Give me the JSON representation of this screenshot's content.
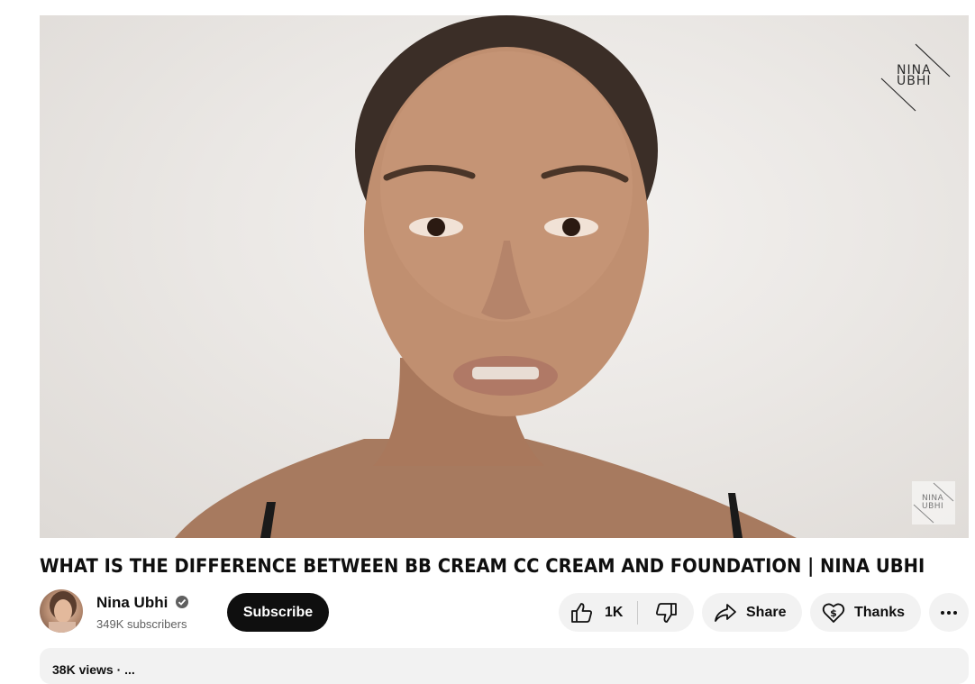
{
  "video": {
    "watermark_line1": "NINA",
    "watermark_line2": "UBHI",
    "corner_logo_line1": "NINA",
    "corner_logo_line2": "UBHI"
  },
  "title": "WHAT IS THE DIFFERENCE BETWEEN BB CREAM CC CREAM AND FOUNDATION | NINA UBHI",
  "channel": {
    "name": "Nina Ubhi",
    "subscribers": "349K subscribers",
    "subscribe_label": "Subscribe"
  },
  "actions": {
    "like_count": "1K",
    "share_label": "Share",
    "thanks_label": "Thanks"
  },
  "description": {
    "preview": "38K views  ·  ..."
  },
  "icons": [
    "thumbs-up-icon",
    "thumbs-down-icon",
    "share-arrow-icon",
    "thanks-heart-dollar-icon",
    "more-horizontal-icon",
    "verified-check-icon"
  ]
}
